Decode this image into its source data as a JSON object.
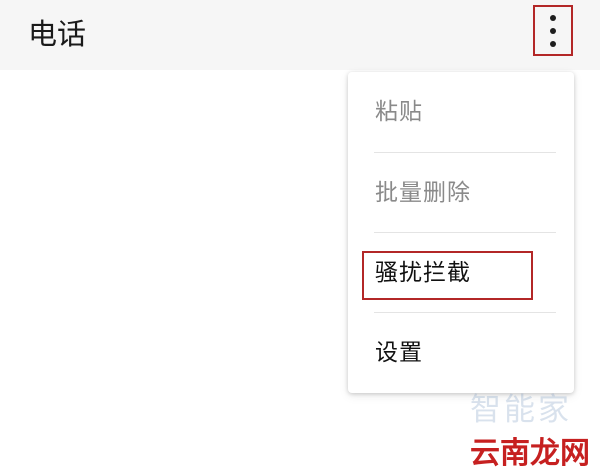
{
  "appbar": {
    "title": "电话",
    "overflow_icon": "more-vert-icon"
  },
  "menu": {
    "items": [
      {
        "label": "粘贴",
        "enabled": false
      },
      {
        "label": "批量删除",
        "enabled": false
      },
      {
        "label": "骚扰拦截",
        "enabled": true,
        "highlighted": true
      },
      {
        "label": "设置",
        "enabled": true
      }
    ]
  },
  "watermark": {
    "top": "智能家",
    "bottom": "云南龙网"
  },
  "colors": {
    "highlight": "#b32727",
    "appbar_bg": "#f6f6f6",
    "disabled_text": "#8a8a8a"
  }
}
